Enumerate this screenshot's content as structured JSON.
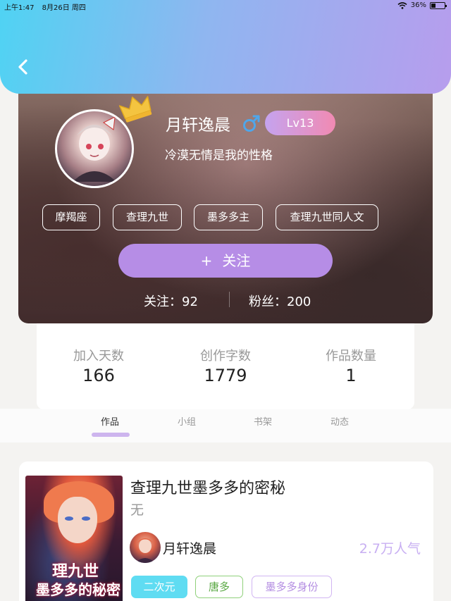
{
  "status_bar": {
    "time": "上午1:47",
    "date": "8月26日 周四",
    "battery": "36%",
    "battery_level": 0.36
  },
  "header": {
    "back_icon": "chevron-left-icon",
    "gradient_start": "#4fd3f3",
    "gradient_end": "#b79ded"
  },
  "profile": {
    "username": "月轩逸晨",
    "gender_icon": "male-symbol-icon",
    "level": "Lv13",
    "signature": "冷漠无情是我的性格",
    "tags": [
      "摩羯座",
      "查理九世",
      "墨多多主",
      "查理九世同人文"
    ],
    "follow_label": "关注",
    "follow_prefix": "+",
    "following_label": "关注：",
    "following_count": "92",
    "fans_label": "粉丝：",
    "fans_count": "200",
    "accent_color": "#b68de6"
  },
  "stats": [
    {
      "label": "加入天数",
      "value": "166"
    },
    {
      "label": "创作字数",
      "value": "1779"
    },
    {
      "label": "作品数量",
      "value": "1"
    }
  ],
  "tabs": [
    {
      "label": "作品",
      "active": true
    },
    {
      "label": "小组",
      "active": false
    },
    {
      "label": "书架",
      "active": false
    },
    {
      "label": "动态",
      "active": false
    }
  ],
  "work": {
    "title": "查理九世墨多多的密秘",
    "description": "无",
    "cover_title": "理九世",
    "cover_subtitle": "墨多多的秘密",
    "author": "月轩逸晨",
    "popularity": "2.7万人气",
    "tags": [
      {
        "label": "二次元",
        "style": "filled-cyan"
      },
      {
        "label": "唐多",
        "style": "outline-green"
      },
      {
        "label": "墨多多身份",
        "style": "outline-purple"
      }
    ]
  }
}
